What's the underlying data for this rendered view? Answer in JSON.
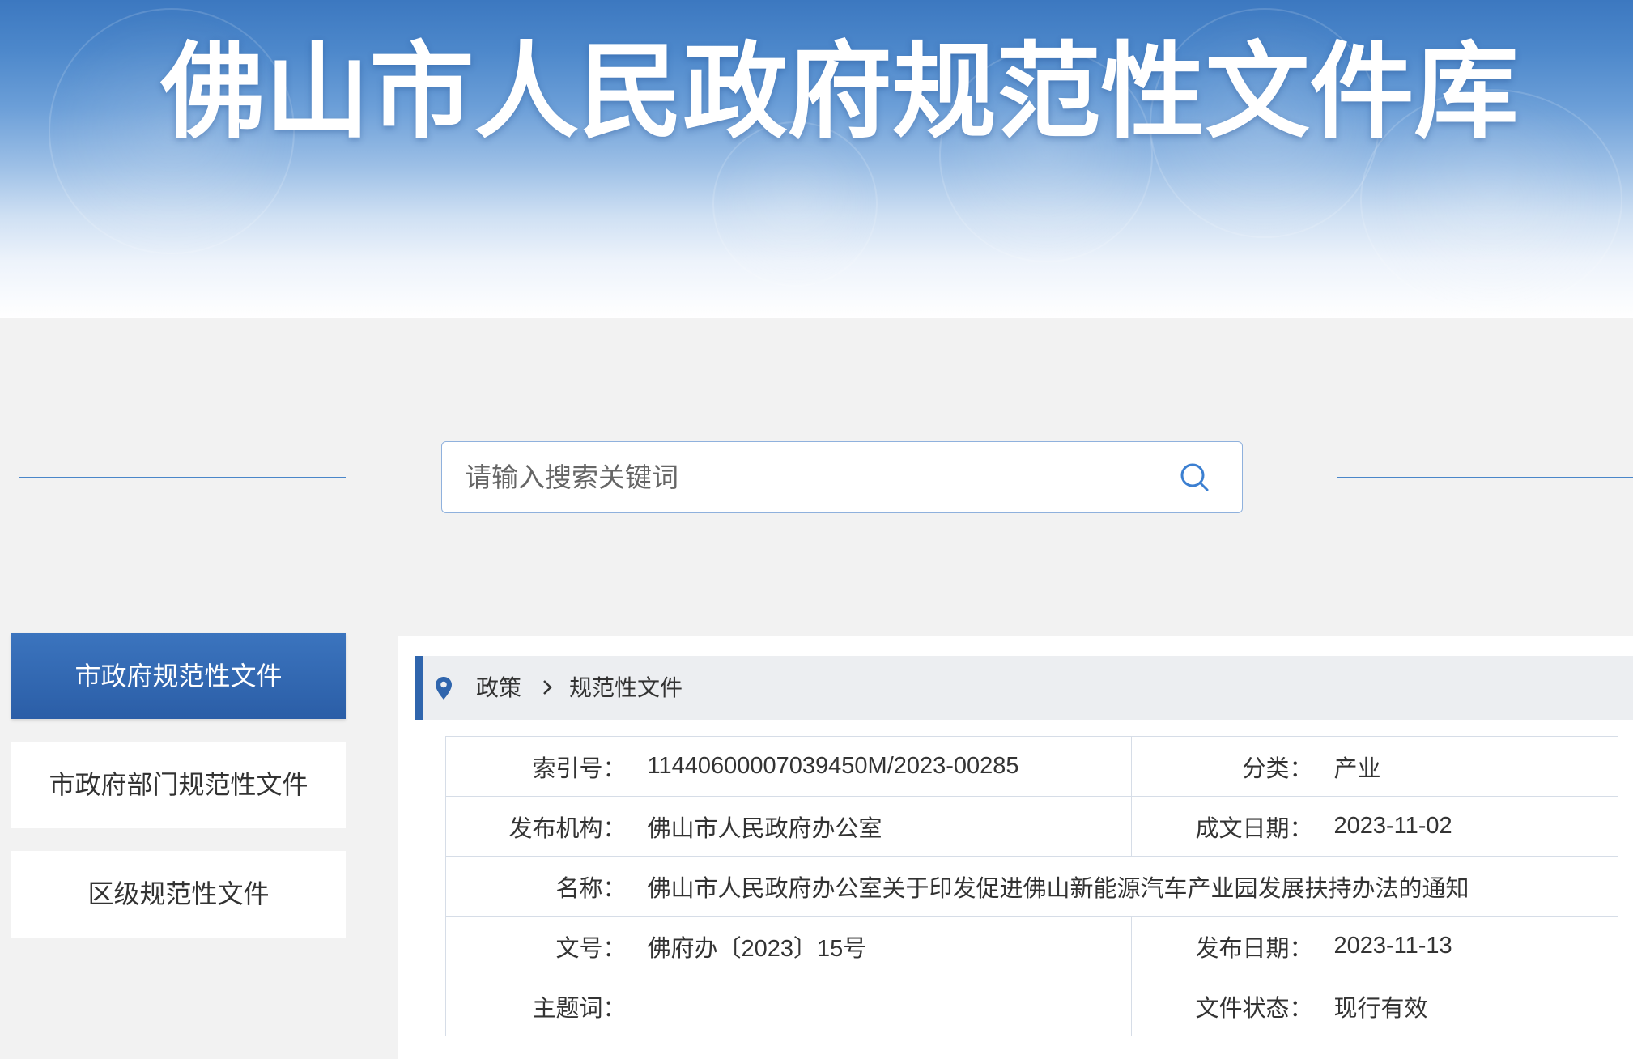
{
  "header": {
    "title": "佛山市人民政府规范性文件库"
  },
  "search": {
    "placeholder": "请输入搜索关键词",
    "value": "",
    "icon": "search-icon"
  },
  "sidebar": {
    "items": [
      {
        "label": "市政府规范性文件",
        "active": true
      },
      {
        "label": "市政府部门规范性文件",
        "active": false
      },
      {
        "label": "区级规范性文件",
        "active": false
      }
    ]
  },
  "breadcrumb": {
    "icon": "location-pin-icon",
    "separator_icon": "chevron-right-icon",
    "items": [
      "政策",
      "规范性文件"
    ]
  },
  "document_info": {
    "index_no": {
      "label": "索引号：",
      "value": "11440600007039450M/2023-00285"
    },
    "category": {
      "label": "分类：",
      "value": "产业"
    },
    "issuer": {
      "label": "发布机构：",
      "value": "佛山市人民政府办公室"
    },
    "written_date": {
      "label": "成文日期：",
      "value": "2023-11-02"
    },
    "name": {
      "label": "名称：",
      "value": "佛山市人民政府办公室关于印发促进佛山新能源汽车产业园发展扶持办法的通知"
    },
    "doc_no": {
      "label": "文号：",
      "value": "佛府办〔2023〕15号"
    },
    "publish_date": {
      "label": "发布日期：",
      "value": "2023-11-13"
    },
    "keywords": {
      "label": "主题词：",
      "value": ""
    },
    "status": {
      "label": "文件状态：",
      "value": "现行有效"
    }
  },
  "colors": {
    "accent": "#2f65ad",
    "search_icon": "#3b7fd1",
    "banner_blue": "#3c78c0",
    "page_background": "#f2f2f2",
    "breadcrumb_background": "#eceef1"
  }
}
